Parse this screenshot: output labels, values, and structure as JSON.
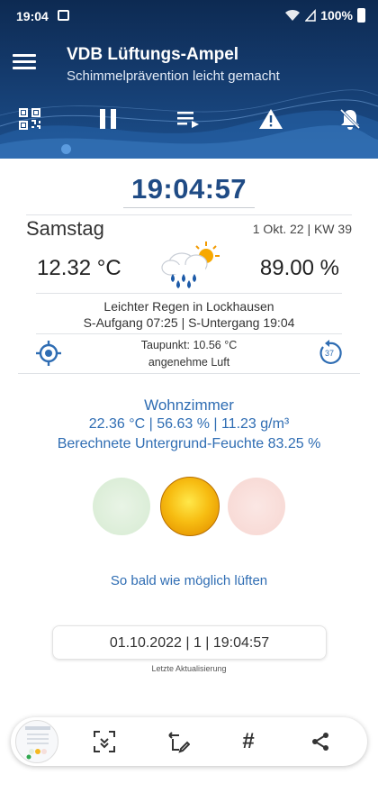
{
  "status_bar": {
    "time": "19:04",
    "battery": "100%"
  },
  "header": {
    "title": "VDB Lüftungs-Ampel",
    "subtitle": "Schimmelprävention leicht gemacht",
    "toolbar_icons": [
      "qr-code-icon",
      "pause-icon",
      "playlist-icon",
      "warning-icon",
      "notifications-off-icon"
    ]
  },
  "clock": "19:04:57",
  "weather": {
    "day": "Samstag",
    "date_kw": "1 Okt. 22 | KW 39",
    "temperature": "12.32 °C",
    "humidity": "89.00 %",
    "icon": "rain-cloud-sun-icon",
    "description": "Leichter Regen in Lockhausen",
    "sun_times": "S-Aufgang 07:25 | S-Untergang 19:04",
    "dew_point": "Taupunkt: 10.56 °C",
    "comfort": "angenehme Luft",
    "refresh_badge": "37"
  },
  "room": {
    "name": "Wohnzimmer",
    "values": "22.36 °C  |  56.63 %  |  11.23 g/m³",
    "substrate": "Berechnete Untergrund-Feuchte 83.25 %"
  },
  "traffic_light": {
    "active": "yellow",
    "colors": {
      "green": "#d6ebd2",
      "yellow": "#f7bd12",
      "red": "#f7d6d1"
    }
  },
  "advice": "So bald wie möglich lüften",
  "last_update": {
    "value": "01.10.2022  |  1  |  19:04:57",
    "label": "Letzte Aktualisierung"
  },
  "bottom_bar": {
    "icons": [
      "screenshot-thumbnail",
      "scroll-capture-icon",
      "edit-icon",
      "hashtag-icon",
      "share-icon"
    ],
    "hash": "#"
  },
  "colors": {
    "header": "#143a6c",
    "accent": "#2f6db3",
    "clock": "#1f4b85"
  }
}
